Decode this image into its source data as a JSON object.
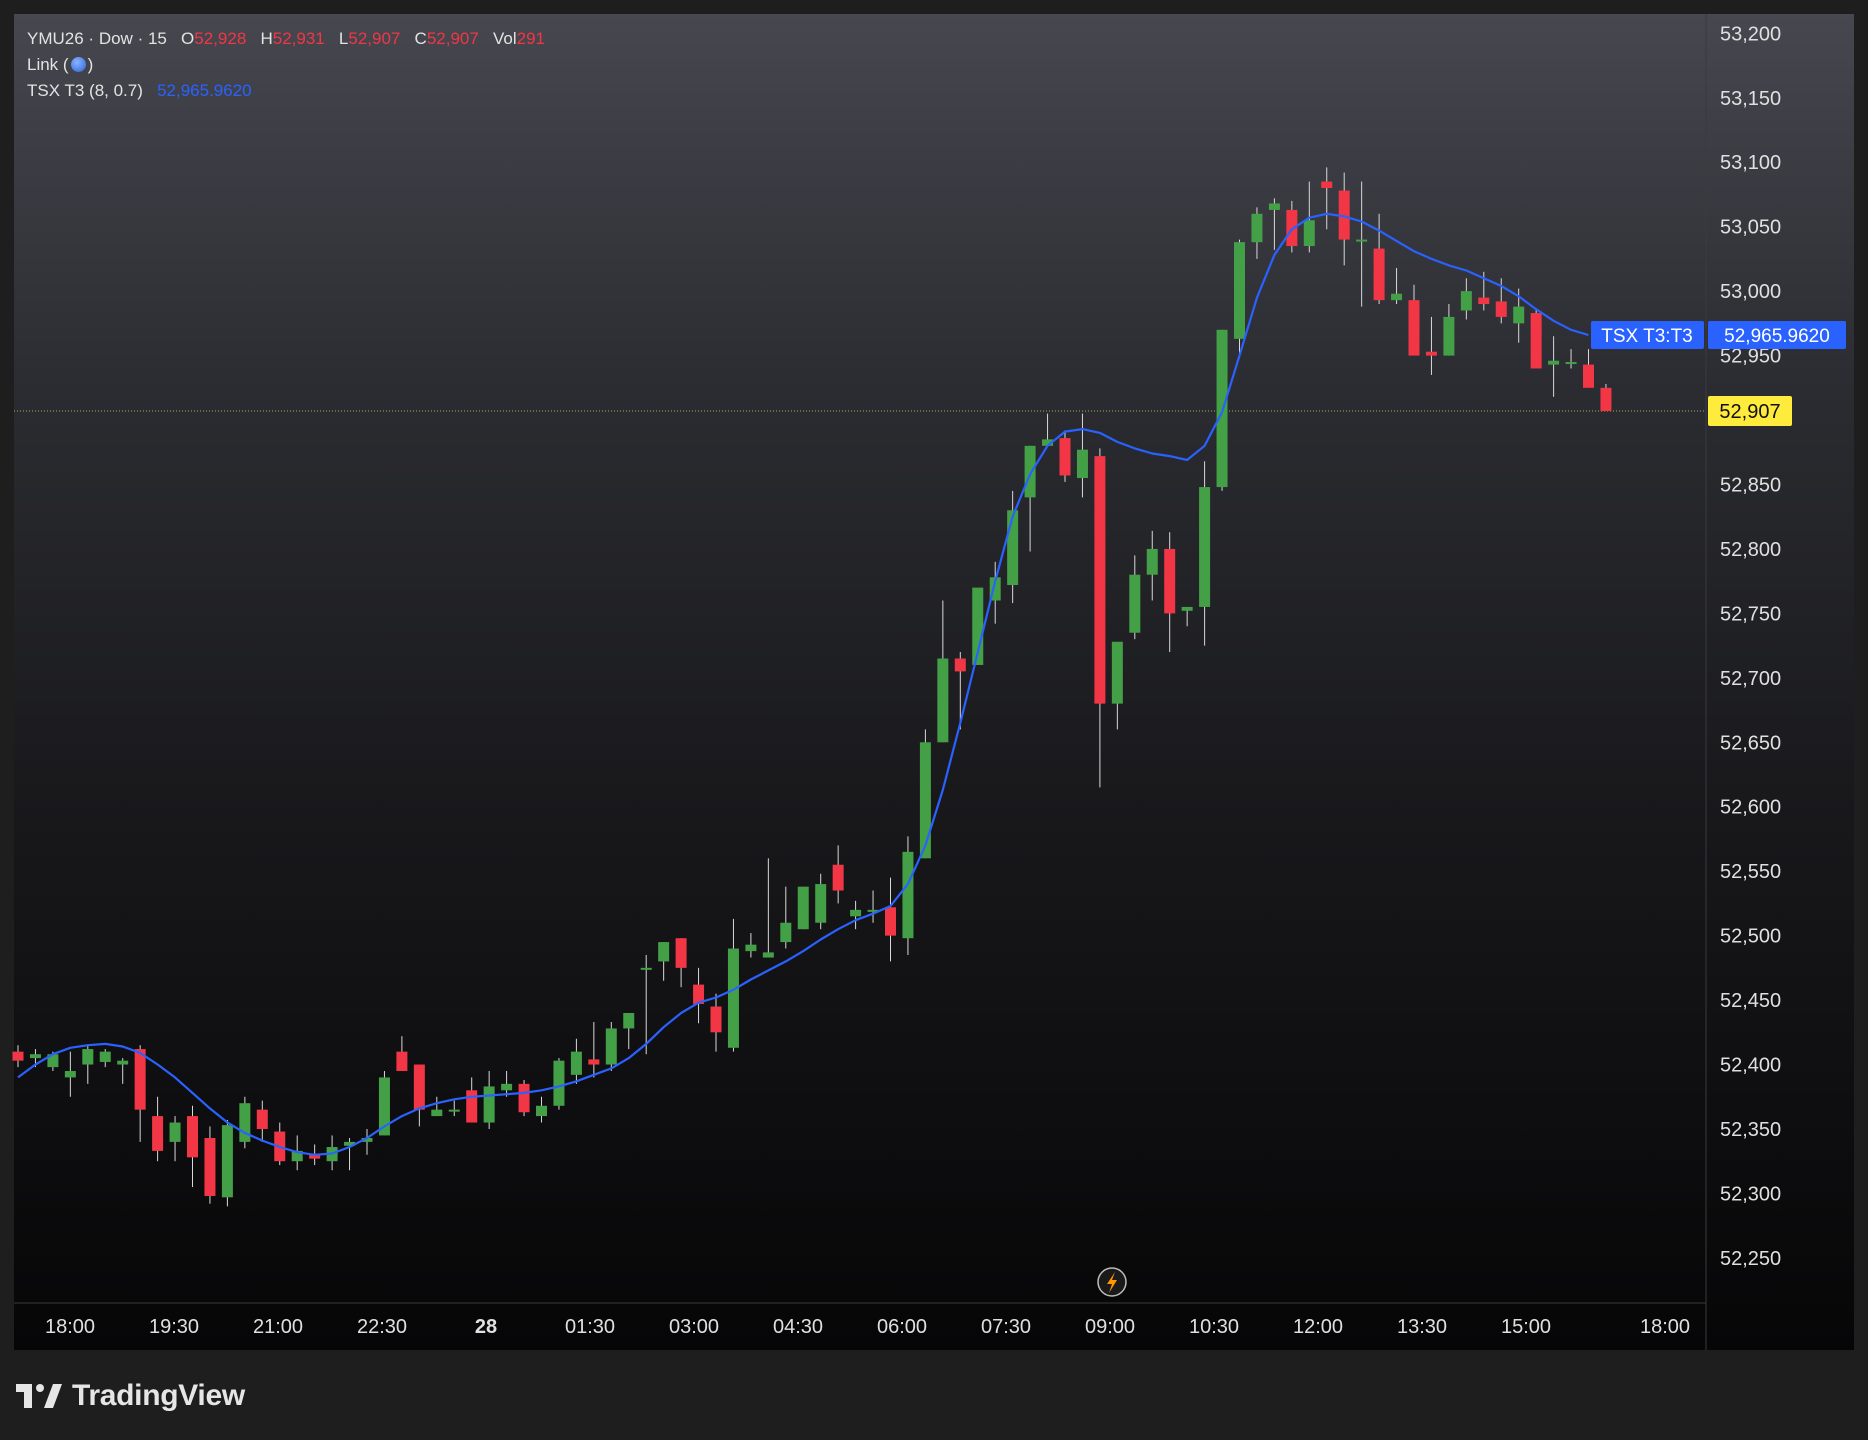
{
  "legend": {
    "symbol": "YMU26",
    "exchange": "Dow",
    "interval": "15",
    "open_label": "O",
    "open": "52,928",
    "high_label": "H",
    "high": "52,931",
    "low_label": "L",
    "low": "52,907",
    "close_label": "C",
    "close": "52,907",
    "vol_label": "Vol",
    "vol": "291",
    "link_label": "Link (",
    "link_close": ")",
    "indicator_name": "TSX T3 (8, 0.7)",
    "indicator_value": "52,965.9620"
  },
  "price_tags": {
    "indicator_tag_label": "TSX T3:T3",
    "indicator_tag_value": "52,965.9620",
    "last_price": "52,907"
  },
  "colors": {
    "up": "#43a047",
    "down": "#f23645",
    "ma_line": "#2962ff",
    "last_price_tag": "#ffeb3b"
  },
  "branding": "TradingView",
  "chart_data": {
    "type": "candlestick",
    "y_ticks": [
      "53,200",
      "53,150",
      "53,100",
      "53,050",
      "53,000",
      "52,950",
      "52,850",
      "52,800",
      "52,750",
      "52,700",
      "52,650",
      "52,600",
      "52,550",
      "52,500",
      "52,450",
      "52,400",
      "52,350",
      "52,300",
      "52,250"
    ],
    "y_tick_values": [
      53200,
      53150,
      53100,
      53050,
      53000,
      52950,
      52850,
      52800,
      52750,
      52700,
      52650,
      52600,
      52550,
      52500,
      52450,
      52400,
      52350,
      52300,
      52250
    ],
    "x_ticks": [
      "18:00",
      "19:30",
      "21:00",
      "22:30",
      "28",
      "01:30",
      "03:00",
      "04:30",
      "06:00",
      "07:30",
      "09:00",
      "10:30",
      "12:00",
      "13:30",
      "15:00",
      "18:00"
    ],
    "x_tick_bold": [
      false,
      false,
      false,
      false,
      true,
      false,
      false,
      false,
      false,
      false,
      false,
      false,
      false,
      false,
      false,
      false
    ],
    "ylim": [
      52215,
      53215
    ],
    "candles": [
      [
        52410,
        52415,
        52398,
        52403
      ],
      [
        52405,
        52412,
        52398,
        52408
      ],
      [
        52398,
        52410,
        52395,
        52408
      ],
      [
        52390,
        52410,
        52375,
        52395
      ],
      [
        52400,
        52415,
        52385,
        52412
      ],
      [
        52402,
        52412,
        52398,
        52410
      ],
      [
        52400,
        52405,
        52385,
        52403
      ],
      [
        52412,
        52415,
        52340,
        52365
      ],
      [
        52360,
        52375,
        52325,
        52333
      ],
      [
        52340,
        52360,
        52325,
        52355
      ],
      [
        52360,
        52368,
        52305,
        52328
      ],
      [
        52343,
        52352,
        52292,
        52298
      ],
      [
        52297,
        52357,
        52290,
        52353
      ],
      [
        52340,
        52375,
        52335,
        52370
      ],
      [
        52365,
        52372,
        52340,
        52350
      ],
      [
        52348,
        52355,
        52322,
        52325
      ],
      [
        52325,
        52345,
        52318,
        52333
      ],
      [
        52330,
        52338,
        52322,
        52327
      ],
      [
        52325,
        52345,
        52318,
        52336
      ],
      [
        52337,
        52343,
        52318,
        52340
      ],
      [
        52340,
        52350,
        52330,
        52343
      ],
      [
        52345,
        52395,
        52345,
        52390
      ],
      [
        52410,
        52422,
        52395,
        52395
      ],
      [
        52400,
        52400,
        52352,
        52365
      ],
      [
        52360,
        52375,
        52360,
        52365
      ],
      [
        52365,
        52372,
        52360,
        52365
      ],
      [
        52380,
        52390,
        52355,
        52355
      ],
      [
        52355,
        52395,
        52350,
        52383
      ],
      [
        52380,
        52395,
        52375,
        52385
      ],
      [
        52385,
        52388,
        52360,
        52363
      ],
      [
        52360,
        52375,
        52355,
        52368
      ],
      [
        52368,
        52405,
        52365,
        52403
      ],
      [
        52392,
        52420,
        52385,
        52410
      ],
      [
        52404,
        52433,
        52390,
        52400
      ],
      [
        52400,
        52433,
        52395,
        52428
      ],
      [
        52428,
        52440,
        52412,
        52440
      ],
      [
        52475,
        52485,
        52408,
        52475
      ],
      [
        52480,
        52495,
        52465,
        52495
      ],
      [
        52498,
        52498,
        52460,
        52475
      ],
      [
        52462,
        52475,
        52432,
        52447
      ],
      [
        52445,
        52455,
        52410,
        52425
      ],
      [
        52413,
        52513,
        52410,
        52490
      ],
      [
        52488,
        52502,
        52483,
        52493
      ],
      [
        52483,
        52560,
        52483,
        52487
      ],
      [
        52495,
        52538,
        52490,
        52510
      ],
      [
        52505,
        52533,
        52505,
        52538
      ],
      [
        52510,
        52548,
        52505,
        52540
      ],
      [
        52555,
        52570,
        52525,
        52535
      ],
      [
        52515,
        52527,
        52505,
        52520
      ],
      [
        52520,
        52535,
        52510,
        52520
      ],
      [
        52522,
        52545,
        52480,
        52500
      ],
      [
        52498,
        52577,
        52485,
        52565
      ],
      [
        52560,
        52660,
        52560,
        52650
      ],
      [
        52650,
        52760,
        52650,
        52715
      ],
      [
        52715,
        52720,
        52660,
        52705
      ],
      [
        52710,
        52755,
        52710,
        52770
      ],
      [
        52760,
        52790,
        52742,
        52778
      ],
      [
        52772,
        52845,
        52758,
        52830
      ],
      [
        52840,
        52880,
        52798,
        52880
      ],
      [
        52880,
        52905,
        52880,
        52885
      ],
      [
        52886,
        52892,
        52852,
        52857
      ],
      [
        52855,
        52905,
        52840,
        52877
      ],
      [
        52872,
        52878,
        52615,
        52680
      ],
      [
        52680,
        52718,
        52660,
        52728
      ],
      [
        52735,
        52795,
        52730,
        52780
      ],
      [
        52780,
        52814,
        52760,
        52800
      ],
      [
        52800,
        52813,
        52720,
        52750
      ],
      [
        52752,
        52755,
        52740,
        52755
      ],
      [
        52755,
        52868,
        52725,
        52848
      ],
      [
        52848,
        52970,
        52845,
        52970
      ],
      [
        52963,
        53040,
        52948,
        53038
      ],
      [
        53038,
        53065,
        53025,
        53060
      ],
      [
        53063,
        53072,
        53032,
        53068
      ],
      [
        53063,
        53070,
        53030,
        53035
      ],
      [
        53035,
        53085,
        53030,
        53055
      ],
      [
        53085,
        53096,
        53048,
        53080
      ],
      [
        53078,
        53092,
        53020,
        53040
      ],
      [
        53040,
        53085,
        52988,
        53040
      ],
      [
        53033,
        53060,
        52990,
        52993
      ],
      [
        52993,
        53018,
        52990,
        52998
      ],
      [
        52993,
        53005,
        52955,
        52950
      ],
      [
        52953,
        52980,
        52935,
        52950
      ],
      [
        52950,
        52990,
        52950,
        52980
      ],
      [
        52985,
        53010,
        52978,
        53000
      ],
      [
        52995,
        53015,
        52985,
        52990
      ],
      [
        52992,
        53010,
        52975,
        52980
      ],
      [
        52975,
        53002,
        52960,
        52988
      ],
      [
        52983,
        52985,
        52945,
        52940
      ],
      [
        52943,
        52965,
        52918,
        52946
      ],
      [
        52945,
        52955,
        52940,
        52945
      ],
      [
        52943,
        52955,
        52930,
        52925
      ],
      [
        52925,
        52928,
        52907,
        52907
      ]
    ],
    "ma_series_name": "TSX T3 (8, 0.7)",
    "ma_values": [
      52390,
      52400,
      52408,
      52413,
      52415,
      52416,
      52414,
      52409,
      52400,
      52390,
      52378,
      52366,
      52355,
      52347,
      52341,
      52336,
      52332,
      52330,
      52331,
      52336,
      52343,
      52352,
      52360,
      52366,
      52370,
      52373,
      52375,
      52376,
      52377,
      52378,
      52380,
      52383,
      52387,
      52392,
      52397,
      52405,
      52416,
      52429,
      52440,
      52448,
      52452,
      52458,
      52466,
      52473,
      52480,
      52488,
      52497,
      52505,
      52512,
      52517,
      52523,
      52540,
      52570,
      52613,
      52665,
      52720,
      52775,
      52825,
      52858,
      52880,
      52891,
      52893,
      52890,
      52883,
      52878,
      52874,
      52872,
      52869,
      52880,
      52906,
      52950,
      52995,
      53028,
      53048,
      53057,
      53060,
      53058,
      53054,
      53047,
      53039,
      53031,
      53025,
      53020,
      53016,
      53010,
      53004,
      52996,
      52986,
      52977,
      52970,
      52966
    ]
  }
}
